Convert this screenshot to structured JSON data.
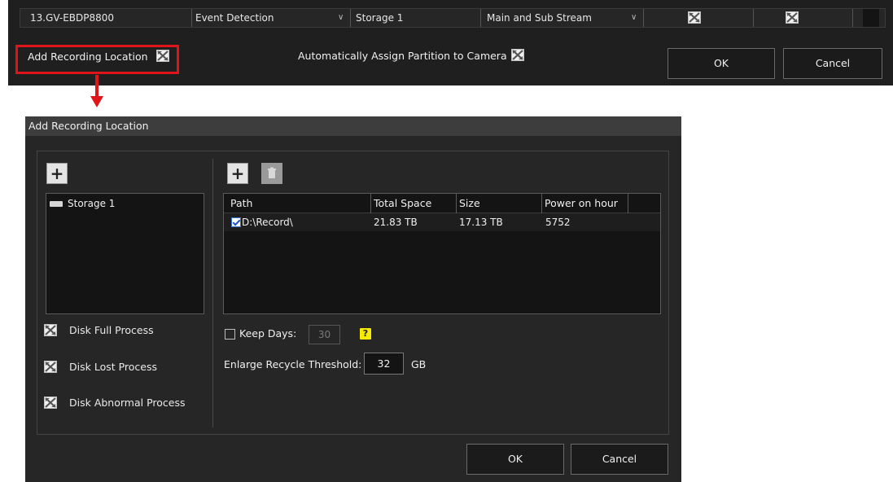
{
  "top_panel": {
    "row": {
      "camera": "13.GV-EBDP8800",
      "mode": "Event Detection",
      "storage": "Storage 1",
      "stream": "Main and Sub Stream"
    },
    "add_recording_location_label": "Add Recording Location",
    "auto_assign_label": "Automatically Assign Partition to Camera",
    "ok_label": "OK",
    "cancel_label": "Cancel"
  },
  "dialog": {
    "title": "Add Recording Location",
    "storage_items": [
      {
        "label": "Storage 1"
      }
    ],
    "processes": [
      {
        "label": "Disk Full Process"
      },
      {
        "label": "Disk Lost Process"
      },
      {
        "label": "Disk Abnormal Process"
      }
    ],
    "table": {
      "columns": [
        "Path",
        "Total Space",
        "Size",
        "Power on hour"
      ],
      "rows": [
        {
          "path": "D:\\Record\\",
          "total_space": "21.83 TB",
          "size": "17.13 TB",
          "power_on_hour": "5752",
          "checked": true
        }
      ]
    },
    "keep_days": {
      "label": "Keep Days:",
      "value": "30",
      "checked": false,
      "help": "?"
    },
    "enlarge_recycle": {
      "label": "Enlarge Recycle Threshold:",
      "value": "32",
      "unit": "GB"
    },
    "ok_label": "OK",
    "cancel_label": "Cancel"
  },
  "colors": {
    "highlight": "#e0151a",
    "background": "#262626",
    "help_icon": "#f6ea00"
  }
}
